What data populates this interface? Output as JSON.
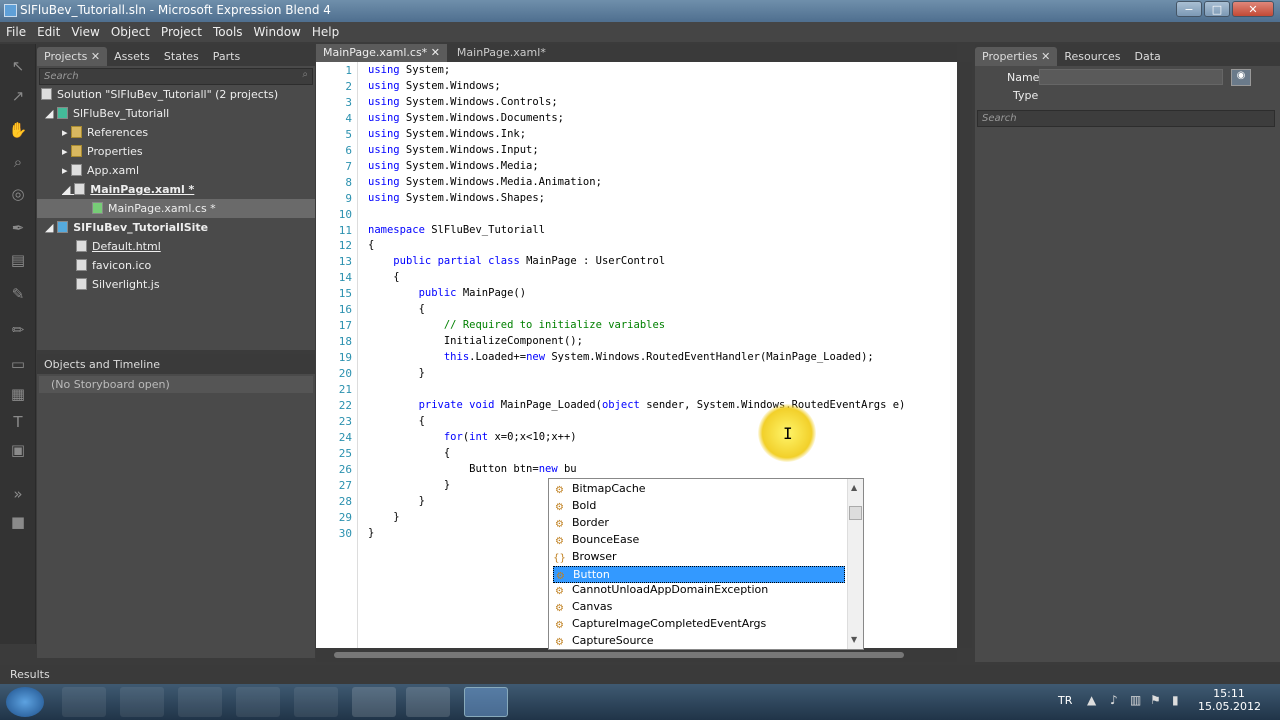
{
  "window": {
    "title": "SlFluBev_Tutoriall.sln - Microsoft Expression Blend 4",
    "min": "−",
    "max": "□",
    "close": "✕"
  },
  "menu": [
    "File",
    "Edit",
    "View",
    "Object",
    "Project",
    "Tools",
    "Window",
    "Help"
  ],
  "left_panel": {
    "tabs": [
      "Projects",
      "Assets",
      "States",
      "Parts"
    ],
    "search_placeholder": "Search",
    "tree": [
      {
        "label": "Solution \"SlFluBev_Tutoriall\" (2 projects)"
      },
      {
        "label": "SlFluBev_Tutoriall"
      },
      {
        "label": "References"
      },
      {
        "label": "Properties"
      },
      {
        "label": "App.xaml"
      },
      {
        "label": "MainPage.xaml *"
      },
      {
        "label": "MainPage.xaml.cs *"
      },
      {
        "label": "SlFluBev_TutoriallSite"
      },
      {
        "label": "Default.html"
      },
      {
        "label": "favicon.ico"
      },
      {
        "label": "Silverlight.js"
      }
    ],
    "objects_title": "Objects and Timeline",
    "storyboard": "(No Storyboard open)"
  },
  "doc_tabs": [
    "MainPage.xaml.cs*",
    "MainPage.xaml*"
  ],
  "code": {
    "line_numbers": [
      "1",
      "2",
      "3",
      "4",
      "5",
      "6",
      "7",
      "8",
      "9",
      "10",
      "11",
      "12",
      "13",
      "14",
      "15",
      "16",
      "17",
      "18",
      "19",
      "20",
      "21",
      "22",
      "23",
      "24",
      "25",
      "26",
      "27",
      "28",
      "29",
      "30"
    ],
    "lines": [
      "using System;",
      "using System.Windows;",
      "using System.Windows.Controls;",
      "using System.Windows.Documents;",
      "using System.Windows.Ink;",
      "using System.Windows.Input;",
      "using System.Windows.Media;",
      "using System.Windows.Media.Animation;",
      "using System.Windows.Shapes;",
      "",
      "namespace SlFluBev_Tutoriall",
      "{",
      "    public partial class MainPage : UserControl",
      "    {",
      "        public MainPage()",
      "        {",
      "            // Required to initialize variables",
      "            InitializeComponent();",
      "            this.Loaded+=new System.Windows.RoutedEventHandler(MainPage_Loaded);",
      "        }",
      "",
      "        private void MainPage_Loaded(object sender, System.Windows.RoutedEventArgs e)",
      "        {",
      "            for(int x=0;x<10;x++)",
      "            {",
      "                Button btn=new bu",
      "            }",
      "        }",
      "    }",
      "}"
    ]
  },
  "autocomplete": {
    "items": [
      "BitmapCache",
      "Bold",
      "Border",
      "BounceEase",
      "Browser",
      "Button",
      "CannotUnloadAppDomainException",
      "Canvas",
      "CaptureImageCompletedEventArgs",
      "CaptureSource"
    ],
    "icons": [
      "⚙",
      "⚙",
      "⚙",
      "⚙",
      "{}",
      "⚙",
      "⚙",
      "⚙",
      "⚙",
      "⚙"
    ],
    "selected": "Button"
  },
  "right_panel": {
    "tabs": [
      "Properties",
      "Resources",
      "Data"
    ],
    "name_label": "Name",
    "type_label": "Type",
    "search_placeholder": "Search"
  },
  "results_label": "Results",
  "tray": {
    "lang": "TR",
    "time": "15:11",
    "date": "15.05.2012"
  }
}
